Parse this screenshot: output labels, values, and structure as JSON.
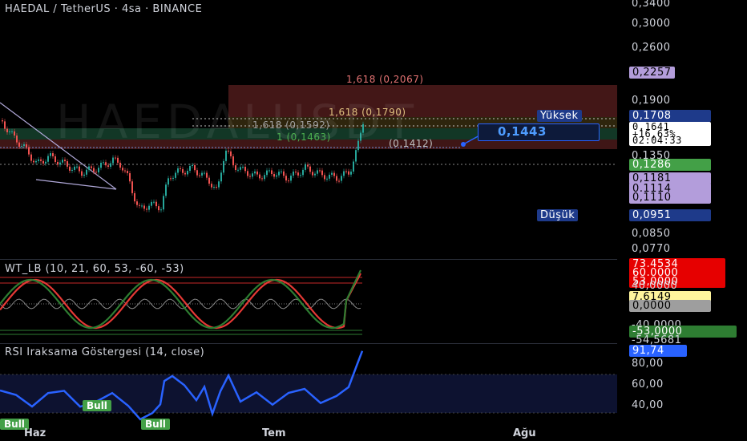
{
  "header": {
    "title": "HAEDAL / TetherUS · 4sa · BINANCE"
  },
  "watermark": "HAEDALUSDT",
  "price_axis": {
    "ticks": [
      "0,3400",
      "0,3000",
      "0,2600",
      "0,1900",
      "0,1350",
      "0,0850",
      "0,0770"
    ],
    "labels": {
      "fib_top": "0,2257",
      "high": "0,1708",
      "current_price": "0,1641",
      "change": "+16,63%",
      "countdown": "02:04:33",
      "green_level": "0,1286",
      "lav1": "0,1181",
      "lav2": "0,1114",
      "lav3": "0,1110",
      "low": "0,0951"
    },
    "high_tag": "Yüksek",
    "low_tag": "Düşük"
  },
  "annotations": {
    "fib_1618_top": "1,618 (0,2067)",
    "fib_1618_mid": "1,618 (0,1790)",
    "fib_1618_low": "1,618 (0,1592)",
    "fib_1": "1 (0,1463)",
    "fib_05": "(0,1412)",
    "callout_price": "0,1443"
  },
  "wt_panel": {
    "title": "WT_LB (10, 21, 60, 53, -60, -53)",
    "labels": {
      "v1": "73,4534",
      "v2": "60,0000",
      "v3": "53,0000",
      "v4": "40,0000",
      "v5": "7,6149",
      "v6": "0,0000",
      "v7": "-40,0000",
      "v8": "-53,0000",
      "v9": "-54,5681"
    }
  },
  "rsi_panel": {
    "title": "RSI Iraksama Göstergesi (14, close)",
    "current": "91,74",
    "ticks": [
      "80,00",
      "60,00",
      "40,00"
    ],
    "bull_labels": [
      "Bull",
      "Bull",
      "Bull"
    ]
  },
  "x_axis": {
    "ticks": [
      "Haz",
      "Tem",
      "Ağu"
    ]
  },
  "colors": {
    "up": "#26a69a",
    "down": "#ef5350",
    "rsi": "#2962ff",
    "wt_red": "#e53935",
    "wt_green": "#2e7d32",
    "lavender": "#b39ddb",
    "green_label": "#43a047",
    "navy": "#1e3a8a",
    "yellow_chip": "#fff59d"
  }
}
